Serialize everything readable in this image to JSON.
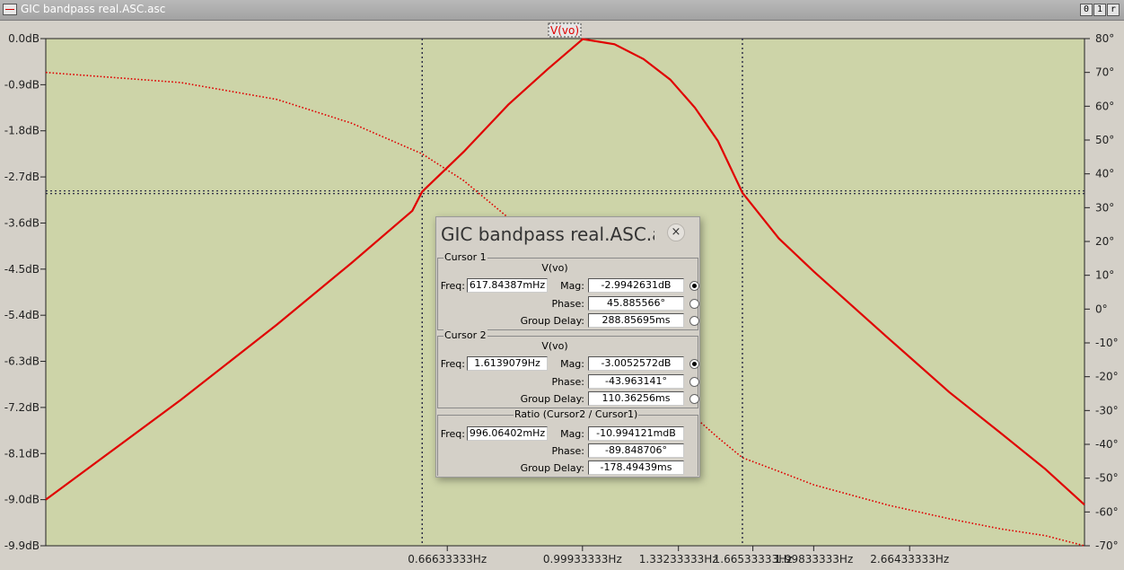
{
  "window": {
    "title": "GIC bandpass real.ASC.asc"
  },
  "window_buttons": [
    "0",
    "1",
    "r"
  ],
  "colors": {
    "plot_bg": "#cdd4a8",
    "trace": "#e00000",
    "axis": "#222222"
  },
  "chart_data": {
    "type": "line",
    "title": "V(vo)",
    "x_scale": "log",
    "x_ticks": [
      "0.66633333Hz",
      "0.99933333Hz",
      "1.33233333Hz",
      "1.66533333Hz",
      "1.99833333Hz",
      "2.66433333Hz"
    ],
    "x_tick_values": [
      0.66633333,
      0.99933333,
      1.33233333,
      1.66533333,
      1.99833333,
      2.66433333
    ],
    "xlim": [
      0.2,
      4.5
    ],
    "y_left_ticks": [
      "0.0dB",
      "-0.9dB",
      "-1.8dB",
      "-2.7dB",
      "-3.6dB",
      "-4.5dB",
      "-5.4dB",
      "-6.3dB",
      "-7.2dB",
      "-8.1dB",
      "-9.0dB",
      "-9.9dB"
    ],
    "ylim_left": [
      -9.9,
      0.0
    ],
    "y_right_ticks": [
      "80°",
      "70°",
      "60°",
      "50°",
      "40°",
      "30°",
      "20°",
      "10°",
      "0°",
      "-10°",
      "-20°",
      "-30°",
      "-40°",
      "-50°",
      "-60°",
      "-70°"
    ],
    "ylim_right": [
      -70,
      80
    ],
    "series": [
      {
        "name": "V(vo)",
        "style": "magnitude-solid",
        "x": [
          0.2,
          0.3,
          0.4,
          0.5,
          0.6,
          0.618,
          0.7,
          0.8,
          0.9,
          1.0,
          1.1,
          1.2,
          1.3,
          1.4,
          1.5,
          1.614,
          1.8,
          2.0,
          2.5,
          3.0,
          3.5,
          4.0,
          4.5
        ],
        "y": [
          -9.0,
          -7.05,
          -5.58,
          -4.38,
          -3.36,
          -2.99,
          -2.21,
          -1.29,
          -0.6,
          -0.01,
          -0.11,
          -0.4,
          -0.8,
          -1.35,
          -2.0,
          -3.01,
          -3.9,
          -4.55,
          -5.85,
          -6.9,
          -7.7,
          -8.4,
          -9.1
        ]
      },
      {
        "name": "V(vo)",
        "style": "phase-dotted",
        "x": [
          0.2,
          0.3,
          0.4,
          0.5,
          0.618,
          0.7,
          0.8,
          0.9,
          1.0,
          1.1,
          1.2,
          1.3,
          1.4,
          1.5,
          1.614,
          1.8,
          2.0,
          2.5,
          3.0,
          3.5,
          4.0,
          4.5
        ],
        "y": [
          70,
          67,
          62,
          55,
          45.9,
          38,
          27,
          14,
          0,
          -10,
          -19,
          -26,
          -32,
          -38,
          -43.96,
          -48,
          -52,
          -58,
          -62,
          -65,
          -67,
          -70
        ]
      }
    ],
    "cursors": {
      "x": [
        0.618,
        1.614
      ],
      "y_db": -3.0
    }
  },
  "dialog": {
    "title": "GIC bandpass real.ASC.asc",
    "close": "×",
    "cursor1": {
      "title": "Cursor 1",
      "signal": "V(vo)",
      "freq_label": "Freq:",
      "freq": "617.84387mHz",
      "mag_label": "Mag:",
      "mag": "-2.9942631dB",
      "phase_label": "Phase:",
      "phase": "45.885566°",
      "gd_label": "Group Delay:",
      "gd": "288.85695ms",
      "selected": "mag"
    },
    "cursor2": {
      "title": "Cursor 2",
      "signal": "V(vo)",
      "freq_label": "Freq:",
      "freq": "1.6139079Hz",
      "mag_label": "Mag:",
      "mag": "-3.0052572dB",
      "phase_label": "Phase:",
      "phase": "-43.963141°",
      "gd_label": "Group Delay:",
      "gd": "110.36256ms",
      "selected": "mag"
    },
    "ratio": {
      "title": "Ratio (Cursor2 / Cursor1)",
      "freq_label": "Freq:",
      "freq": "996.06402mHz",
      "mag_label": "Mag:",
      "mag": "-10.994121mdB",
      "phase_label": "Phase:",
      "phase": "-89.848706°",
      "gd_label": "Group Delay:",
      "gd": "-178.49439ms"
    }
  }
}
